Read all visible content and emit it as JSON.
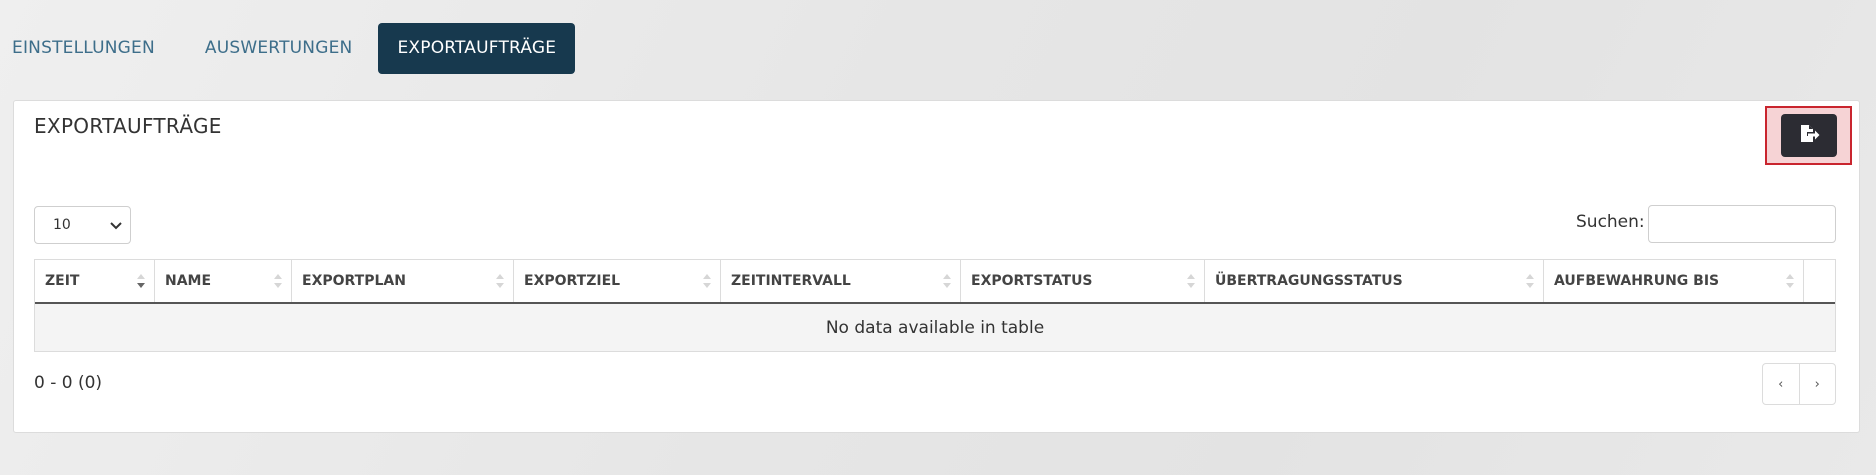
{
  "tabs": [
    {
      "label": "EINSTELLUNGEN",
      "active": false
    },
    {
      "label": "AUSWERTUNGEN",
      "active": false
    },
    {
      "label": "EXPORTAUFTRÄGE",
      "active": true
    }
  ],
  "panel": {
    "title": "EXPORTAUFTRÄGE",
    "export_button_icon": "file-export-icon"
  },
  "table_controls": {
    "length_value": "10",
    "search_label": "Suchen:",
    "search_value": ""
  },
  "table": {
    "columns": [
      "ZEIT",
      "NAME",
      "EXPORTPLAN",
      "EXPORTZIEL",
      "ZEITINTERVALL",
      "EXPORTSTATUS",
      "ÜBERTRAGUNGSSTATUS",
      "AUFBEWAHRUNG BIS"
    ],
    "sorted_column": "ZEIT",
    "empty_message": "No data available in table"
  },
  "footer": {
    "info": "0 - 0 (0)",
    "prev": "‹",
    "next": "›"
  },
  "colors": {
    "active_tab_bg": "#17394e",
    "tab_text": "#3d6e8a",
    "highlight_border": "#c9252e",
    "export_button_bg": "#2c2c33"
  }
}
